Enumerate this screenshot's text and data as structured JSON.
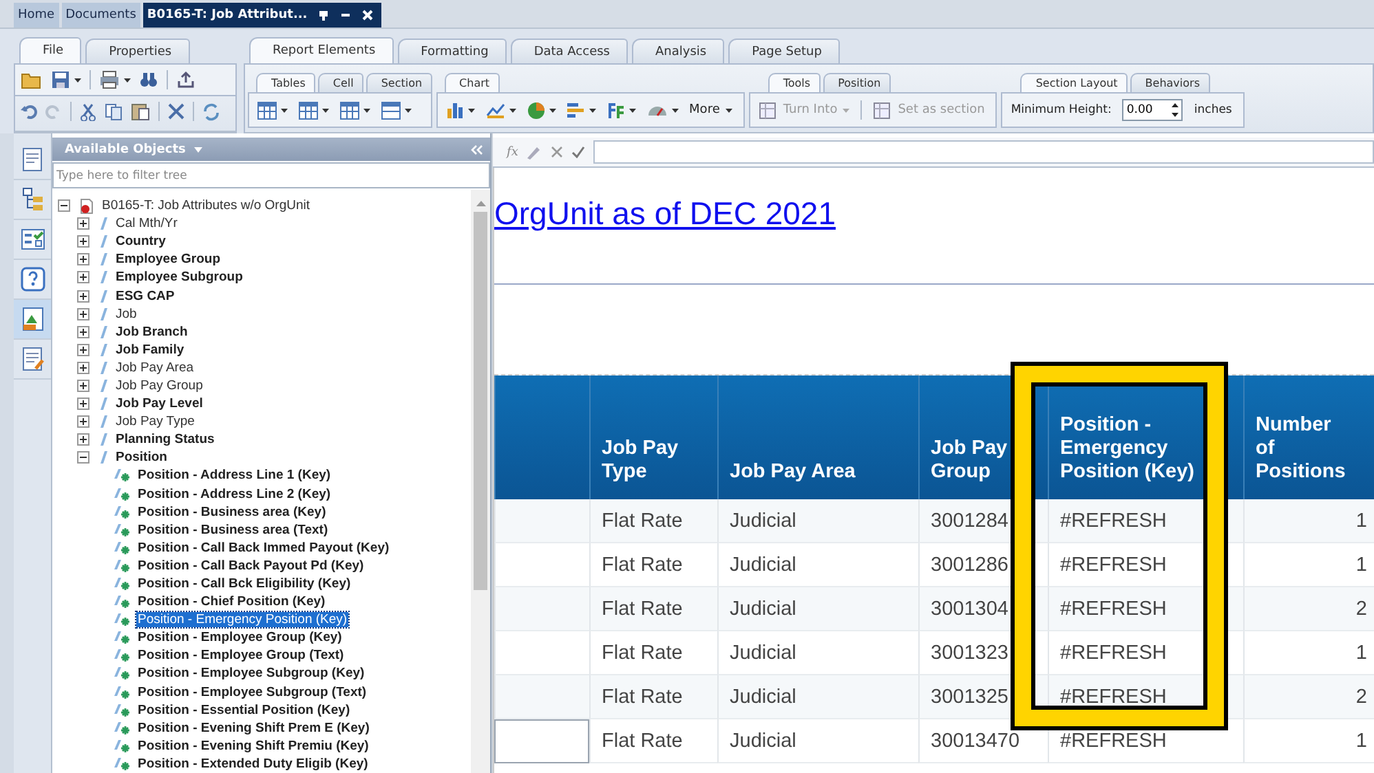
{
  "doc_tabs": [
    {
      "label": "Home",
      "selected": false
    },
    {
      "label": "Documents",
      "selected": false
    },
    {
      "label": "B0165-T: Job Attribut...",
      "selected": true
    }
  ],
  "ribbon_left": {
    "tabs": [
      {
        "label": "File",
        "selected": true
      },
      {
        "label": "Properties",
        "selected": false
      }
    ]
  },
  "ribbon_main": {
    "tabs": [
      {
        "label": "Report Elements",
        "selected": true
      },
      {
        "label": "Formatting",
        "selected": false
      },
      {
        "label": "Data Access",
        "selected": false
      },
      {
        "label": "Analysis",
        "selected": false
      },
      {
        "label": "Page Setup",
        "selected": false
      }
    ],
    "tables_group": {
      "tabs": [
        {
          "label": "Tables",
          "selected": true
        },
        {
          "label": "Cell",
          "selected": false
        },
        {
          "label": "Section",
          "selected": false
        }
      ]
    },
    "chart_group": {
      "tabs": [
        {
          "label": "Chart",
          "selected": true
        }
      ],
      "more_button": "More"
    },
    "tools_group": {
      "tabs": [
        {
          "label": "Tools",
          "selected": true
        },
        {
          "label": "Position",
          "selected": false
        }
      ],
      "buttons": [
        {
          "label": "Turn Into",
          "disabled": true
        },
        {
          "label": "Set as section",
          "disabled": true
        }
      ]
    },
    "layout_group": {
      "tabs": [
        {
          "label": "Section Layout",
          "selected": true
        },
        {
          "label": "Behaviors",
          "selected": false
        }
      ],
      "field_label": "Minimum Height:",
      "field_value": "0.00",
      "unit": "inches"
    }
  },
  "side_strip": [
    {
      "selected": false
    },
    {
      "selected": false
    },
    {
      "selected": false
    },
    {
      "selected": false
    },
    {
      "selected": true
    },
    {
      "selected": false
    }
  ],
  "objects_panel": {
    "title": "Available Objects",
    "filter_placeholder": "Type here to filter tree"
  },
  "tree": {
    "root": {
      "label": "B0165-T: Job Attributes w/o OrgUnit",
      "expanded": true,
      "children": [
        {
          "label": "Cal Mth/Yr",
          "bold": false,
          "expanded": false,
          "selected": false
        },
        {
          "label": "Country",
          "bold": true,
          "expanded": false,
          "selected": false
        },
        {
          "label": "Employee Group",
          "bold": true,
          "expanded": false,
          "selected": false
        },
        {
          "label": "Employee Subgroup",
          "bold": true,
          "expanded": false,
          "selected": false
        },
        {
          "label": "ESG CAP",
          "bold": true,
          "expanded": false,
          "selected": false
        },
        {
          "label": "Job",
          "bold": false,
          "expanded": false,
          "selected": false
        },
        {
          "label": "Job Branch",
          "bold": true,
          "expanded": false,
          "selected": false
        },
        {
          "label": "Job Family",
          "bold": true,
          "expanded": false,
          "selected": false
        },
        {
          "label": "Job Pay Area",
          "bold": false,
          "expanded": false,
          "selected": false
        },
        {
          "label": "Job Pay Group",
          "bold": false,
          "expanded": false,
          "selected": false
        },
        {
          "label": "Job Pay Level",
          "bold": true,
          "expanded": false,
          "selected": false
        },
        {
          "label": "Job Pay Type",
          "bold": false,
          "expanded": false,
          "selected": false
        },
        {
          "label": "Planning Status",
          "bold": true,
          "expanded": false,
          "selected": false
        },
        {
          "label": "Position",
          "bold": true,
          "expanded": true,
          "selected": false,
          "children": [
            {
              "label": "Position - Address Line 1 (Key)",
              "selected": false
            },
            {
              "label": "Position - Address Line 2 (Key)",
              "selected": false
            },
            {
              "label": "Position - Business area (Key)",
              "selected": false
            },
            {
              "label": "Position - Business area (Text)",
              "selected": false
            },
            {
              "label": "Position - Call Back Immed Payout (Key)",
              "selected": false
            },
            {
              "label": "Position - Call Back Payout Pd (Key)",
              "selected": false
            },
            {
              "label": "Position - Call Bck Eligibility (Key)",
              "selected": false
            },
            {
              "label": "Position - Chief Position (Key)",
              "selected": false
            },
            {
              "label": "Position - Emergency Position (Key)",
              "selected": true
            },
            {
              "label": "Position - Employee Group (Key)",
              "selected": false
            },
            {
              "label": "Position - Employee Group (Text)",
              "selected": false
            },
            {
              "label": "Position - Employee Subgroup (Key)",
              "selected": false
            },
            {
              "label": "Position - Employee Subgroup (Text)",
              "selected": false
            },
            {
              "label": "Position - Essential Position (Key)",
              "selected": false
            },
            {
              "label": "Position - Evening Shift Prem E (Key)",
              "selected": false
            },
            {
              "label": "Position - Evening Shift Premiu (Key)",
              "selected": false
            },
            {
              "label": "Position - Extended Duty Eligib (Key)",
              "selected": false
            }
          ]
        }
      ]
    }
  },
  "formula_bar": {
    "label": "fx"
  },
  "report": {
    "title": "OrgUnit as of DEC 2021",
    "table": {
      "columns": [
        {
          "highlighted": false
        },
        {
          "label": "Job Pay Type",
          "highlighted": false
        },
        {
          "label": "Job Pay Area",
          "highlighted": false
        },
        {
          "label": "Job Pay Group",
          "highlighted": false
        },
        {
          "label": "Position - Emergency Position (Key)",
          "highlighted": true
        },
        {
          "label": "Number of Positions",
          "highlighted": false
        }
      ],
      "rows": [
        {
          "selected": false,
          "cells": [
            "",
            "Flat Rate",
            "Judicial",
            "3001284",
            "#REFRESH",
            "1"
          ]
        },
        {
          "selected": false,
          "cells": [
            "",
            "Flat Rate",
            "Judicial",
            "3001286",
            "#REFRESH",
            "1"
          ]
        },
        {
          "selected": false,
          "cells": [
            "",
            "Flat Rate",
            "Judicial",
            "3001304",
            "#REFRESH",
            "2"
          ]
        },
        {
          "selected": false,
          "cells": [
            "",
            "Flat Rate",
            "Judicial",
            "3001323",
            "#REFRESH",
            "1"
          ]
        },
        {
          "selected": false,
          "cells": [
            "",
            "Flat Rate",
            "Judicial",
            "3001325",
            "#REFRESH",
            "2"
          ]
        },
        {
          "selected": true,
          "cells": [
            "",
            "Flat Rate",
            "Judicial",
            "30013470",
            "#REFRESH",
            "1"
          ]
        }
      ]
    }
  }
}
